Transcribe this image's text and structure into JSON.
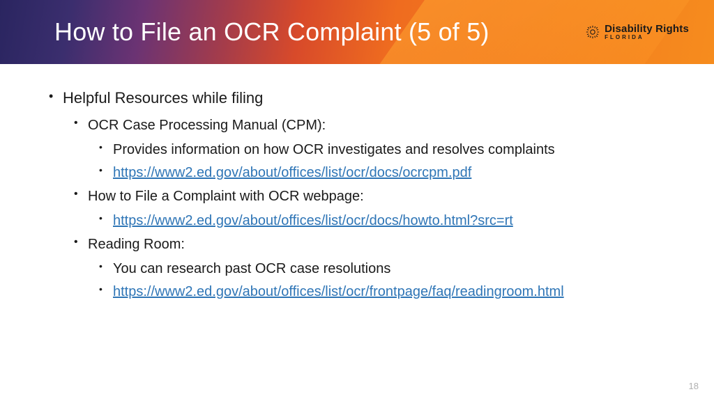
{
  "slide": {
    "title": "How to File an OCR Complaint (5 of 5)",
    "page_number": "18"
  },
  "logo": {
    "main": "Disability Rights",
    "sub": "FLORIDA"
  },
  "content": {
    "heading": "Helpful Resources while filing",
    "sections": [
      {
        "title": "OCR Case Processing Manual (CPM):",
        "items": [
          {
            "text": "Provides information on how OCR investigates and resolves complaints",
            "is_link": false
          },
          {
            "text": "https://www2.ed.gov/about/offices/list/ocr/docs/ocrcpm.pdf",
            "is_link": true
          }
        ]
      },
      {
        "title": "How to File a Complaint with OCR webpage:",
        "items": [
          {
            "text": "https://www2.ed.gov/about/offices/list/ocr/docs/howto.html?src=rt",
            "is_link": true
          }
        ]
      },
      {
        "title": "Reading Room:",
        "items": [
          {
            "text": "You can research past OCR case resolutions",
            "is_link": false
          },
          {
            "text": "https://www2.ed.gov/about/offices/list/ocr/frontpage/faq/readingroom.html",
            "is_link": true
          }
        ]
      }
    ]
  }
}
